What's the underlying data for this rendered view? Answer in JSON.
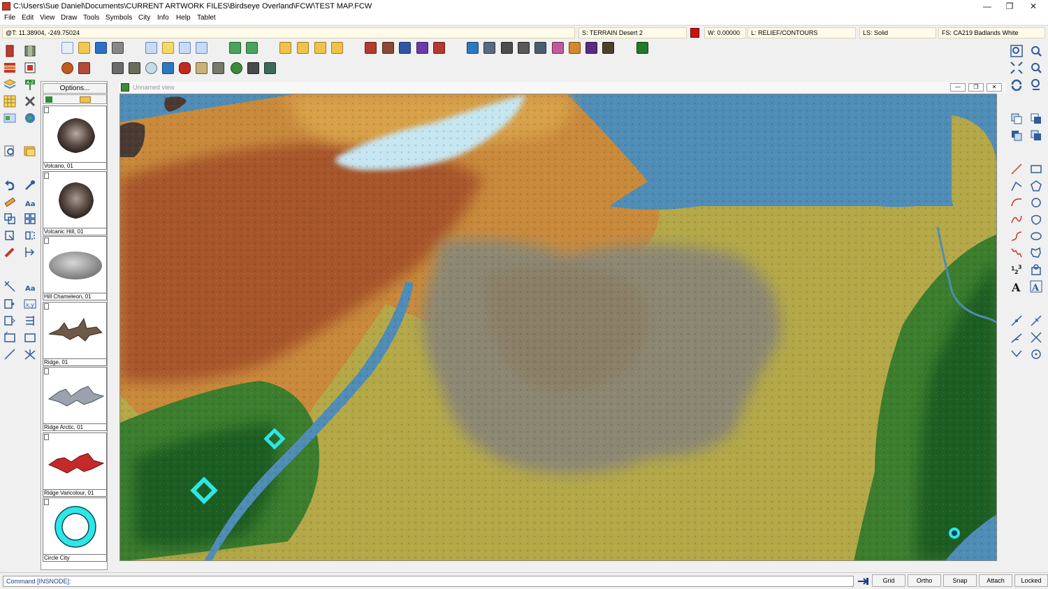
{
  "window": {
    "title": "C:\\Users\\Sue Daniel\\Documents\\CURRENT ARTWORK FILES\\Birdseye Overland\\FCW\\TEST MAP.FCW",
    "minimize": "—",
    "maximize": "❐",
    "close": "✕"
  },
  "menu": [
    "File",
    "Edit",
    "View",
    "Draw",
    "Tools",
    "Symbols",
    "City",
    "Info",
    "Help",
    "Tablet"
  ],
  "status": {
    "coords": "@T: 11.38904, -249.75024",
    "sheet": "S: TERRAIN Desert 2",
    "current_color": "#cc1111",
    "width": "W: 0.00000",
    "layer": "L: RELIEF/CONTOURS",
    "line_style": "LS: Solid",
    "fill_style": "FS: CA219 Badlands White"
  },
  "symbols": {
    "options_label": "Options...",
    "items": [
      {
        "name": "Volcano, 01",
        "kind": "volcano"
      },
      {
        "name": "Volcanic Hill, 01",
        "kind": "volcanic-hill"
      },
      {
        "name": "Hill Chameleon, 01",
        "kind": "hill"
      },
      {
        "name": "Ridge, 01",
        "kind": "ridge"
      },
      {
        "name": "Ridge Arctic, 01",
        "kind": "ridge-arctic"
      },
      {
        "name": "Ridge Varicolour, 01",
        "kind": "ridge-red"
      },
      {
        "name": "Circle City",
        "kind": "circle-city"
      }
    ]
  },
  "view": {
    "title": "Unnamed view"
  },
  "command": {
    "prompt": "Command [INSNODE]:"
  },
  "modes": [
    "Grid",
    "Ortho",
    "Snap",
    "Attach",
    "Locked"
  ]
}
